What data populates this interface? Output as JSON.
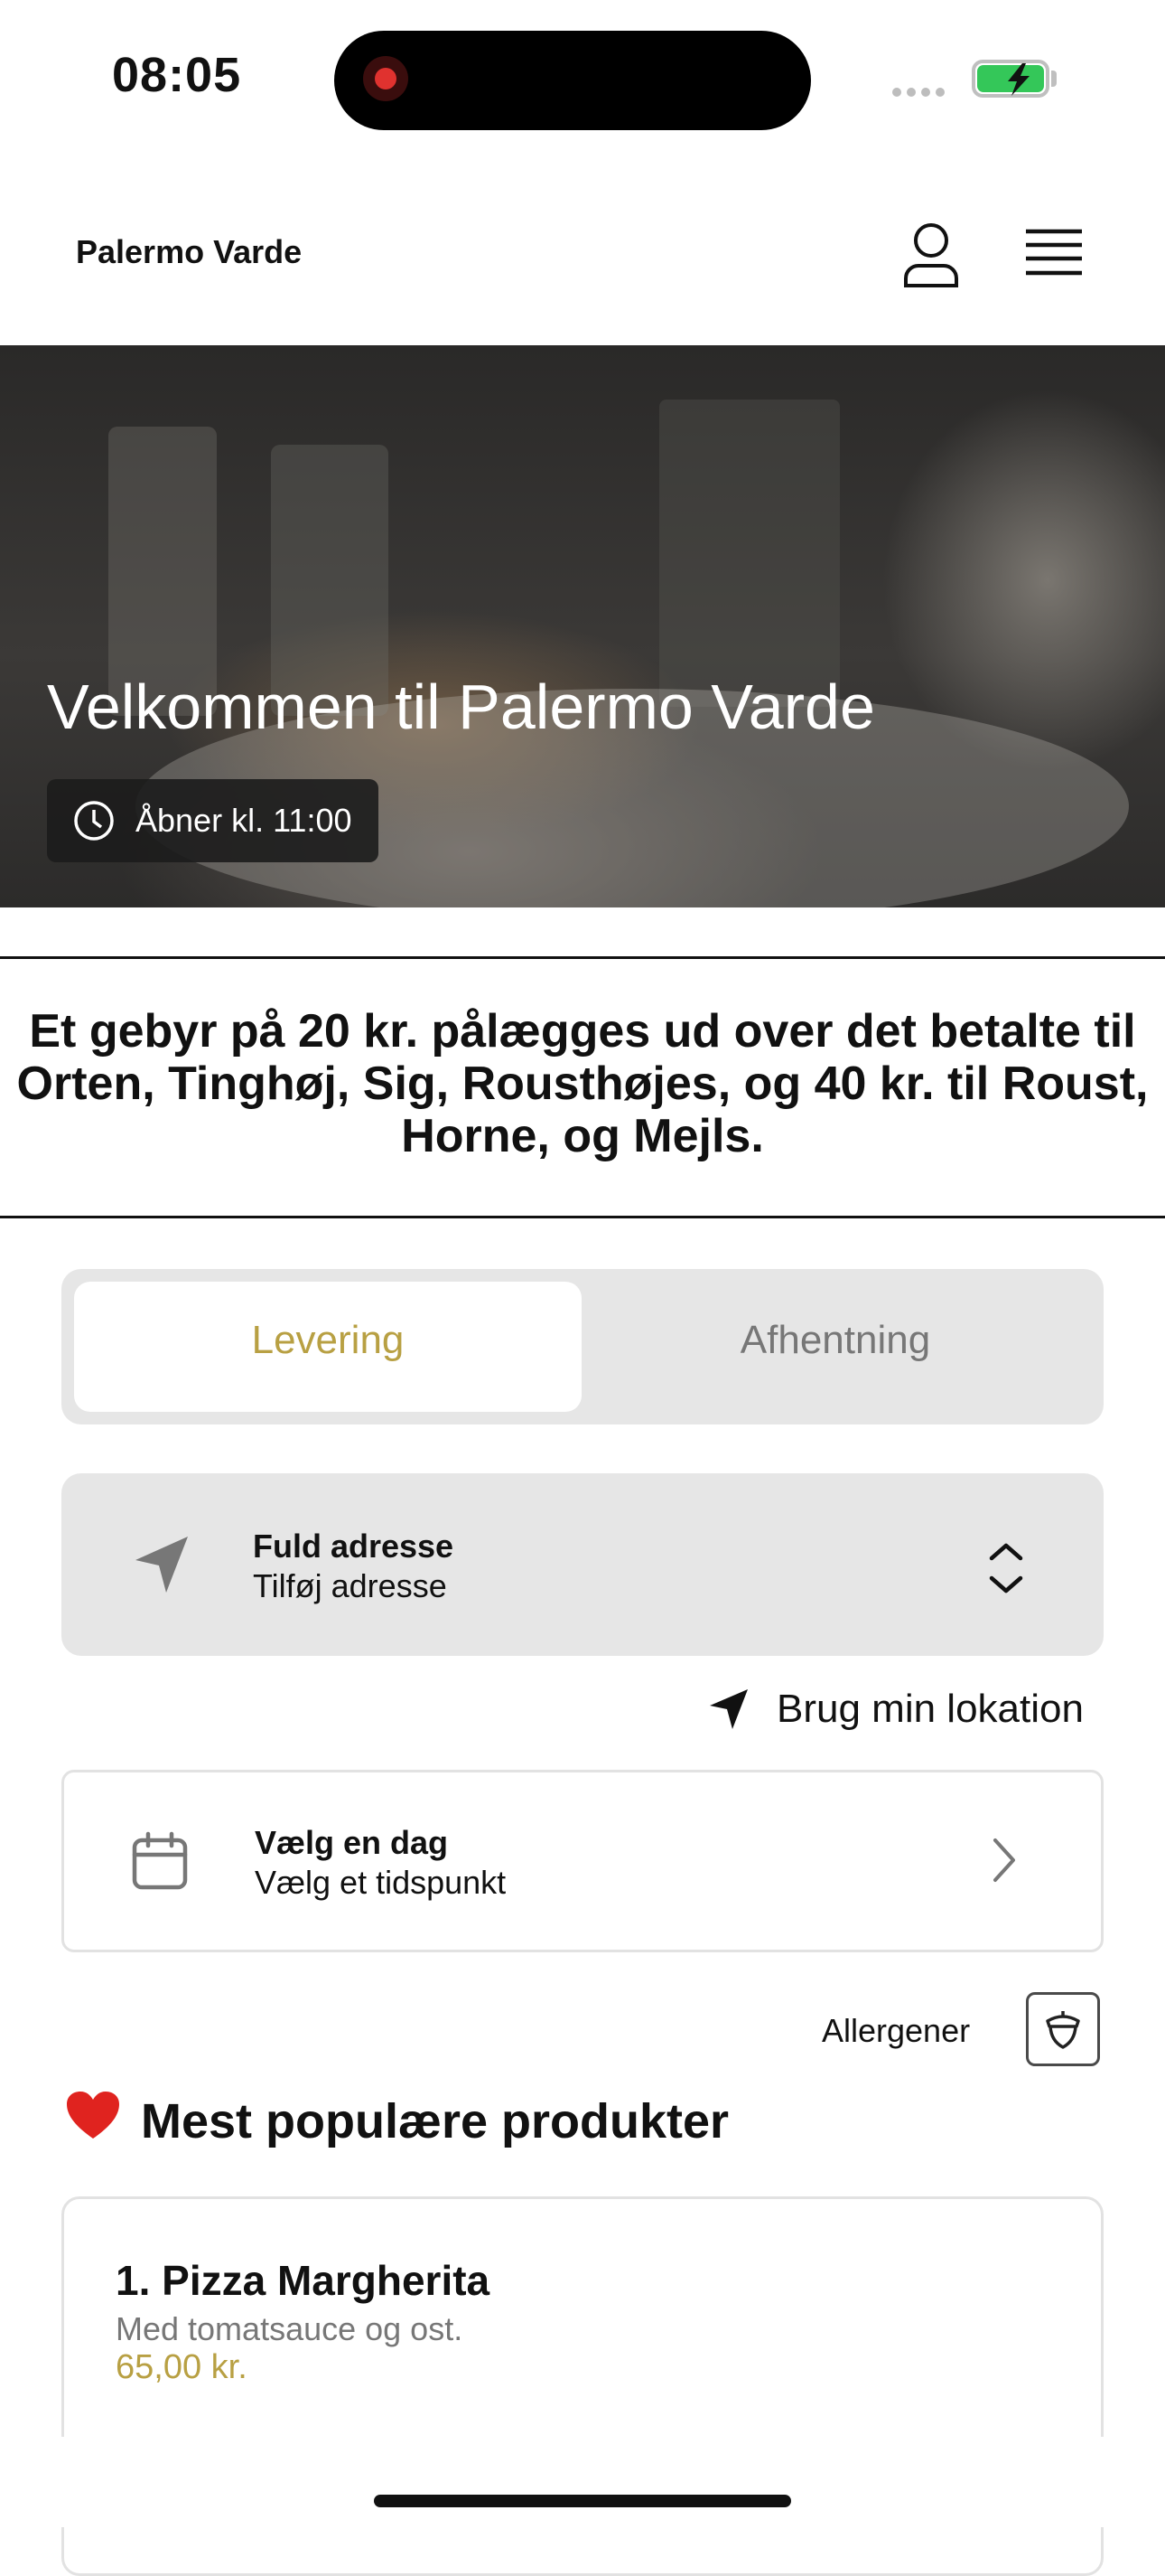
{
  "status_bar": {
    "time": "08:05",
    "icons": [
      "screen-recording-icon",
      "signal-dots-icon",
      "battery-charging-icon"
    ],
    "battery_color": "#34c759"
  },
  "header": {
    "brand": "Palermo Varde",
    "icons": [
      "user-icon",
      "hamburger-menu-icon"
    ]
  },
  "hero": {
    "title": "Velkommen til Palermo Varde",
    "opening_badge": "Åbner kl. 11:00",
    "badge_icon": "clock-icon"
  },
  "notice": {
    "text": "Et gebyr på 20 kr. pålægges ud over det betalte til Orten, Tinghøj, Sig, Rousthøjes, og 40 kr. til Roust, Horne, og Mejls."
  },
  "order_type": {
    "options": [
      "Levering",
      "Afhentning"
    ],
    "selected": "Levering",
    "accent": "#b8a043"
  },
  "address": {
    "title": "Fuld adresse",
    "placeholder": "Tilføj adresse",
    "icon": "location-arrow-icon"
  },
  "use_location": {
    "label": "Brug min lokation",
    "icon": "location-arrow-icon"
  },
  "schedule": {
    "title": "Vælg en dag",
    "subtitle": "Vælg et tidspunkt",
    "icon": "calendar-icon"
  },
  "allergens": {
    "label": "Allergener",
    "icon": "acorn-icon"
  },
  "popular": {
    "emoji": "❤️",
    "title": "Mest populære produkter",
    "products": [
      {
        "name": "1. Pizza Margherita",
        "description": "Med tomatsauce og ost.",
        "price": "65,00 kr."
      }
    ]
  }
}
